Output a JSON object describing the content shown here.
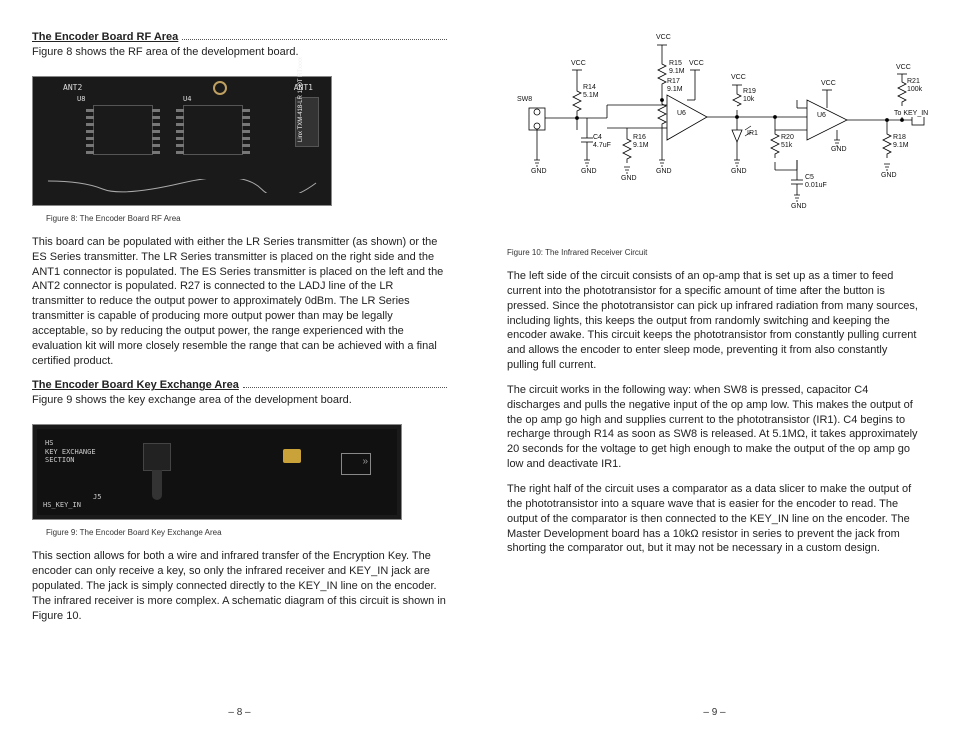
{
  "left": {
    "h1": "The Encoder Board RF Area",
    "p1": "Figure 8 shows the RF area of the development board.",
    "fig8_caption": "Figure 8: The Encoder Board RF Area",
    "fig8_labels": {
      "ant1": "ANT1",
      "ant2": "ANT2",
      "u4": "U4",
      "u8": "U8",
      "chip": "Linx  TXM-418-LR  1LOT RTxxxx"
    },
    "p2": "This board can be populated with either the LR Series transmitter (as shown) or the ES Series transmitter. The LR Series transmitter is placed on the right side and the ANT1 connector is populated. The ES Series transmitter is placed on the left and the ANT2 connector is populated. R27 is connected to the LADJ line of the LR transmitter to reduce the output power to approximately 0dBm. The LR Series transmitter is capable of producing more output power than may be legally acceptable, so by reducing the output power, the range experienced with the evaluation kit will more closely resemble the range that can be achieved with a final certified product.",
    "h2": "The Encoder Board Key Exchange Area",
    "p3": "Figure 9 shows the key exchange area of the development board.",
    "fig9_caption": "Figure 9: The Encoder Board Key Exchange Area",
    "fig9_labels": {
      "hs": "HS\nKEY EXCHANGE\nSECTION",
      "j5": "J5",
      "hk": "HS_KEY_IN"
    },
    "p4": "This section allows for both a wire and infrared transfer of the Encryption Key. The encoder can only receive a key, so only the infrared receiver and KEY_IN jack are populated. The jack is simply connected directly to the KEY_IN line on the encoder. The infrared receiver is more complex. A schematic diagram of this circuit is shown in Figure 10.",
    "pagenum": "– 8 –"
  },
  "right": {
    "fig10_caption": "Figure 10: The Infrared Receiver Circuit",
    "schematic": {
      "nets": {
        "vcc": "VCC",
        "gnd": "GND",
        "keyin": "To KEY_IN"
      },
      "parts": {
        "SW8": "SW8",
        "C4": {
          "ref": "C4",
          "val": "4.7uF"
        },
        "C5": {
          "ref": "C5",
          "val": "0.01uF"
        },
        "R14": {
          "ref": "R14",
          "val": "5.1M"
        },
        "R15": {
          "ref": "R15",
          "val": "9.1M"
        },
        "R16": {
          "ref": "R16",
          "val": "9.1M"
        },
        "R17": {
          "ref": "R17",
          "val": "9.1M"
        },
        "R18": {
          "ref": "R18",
          "val": "9.1M"
        },
        "R19": {
          "ref": "R19",
          "val": "10k"
        },
        "R20": {
          "ref": "R20",
          "val": "51k"
        },
        "R21": {
          "ref": "R21",
          "val": "100k"
        },
        "U6a": "U6",
        "U6b": "U6",
        "IR1": "IR1"
      }
    },
    "p1": "The left side of the circuit consists of an op-amp that is set up as a timer to feed current into the phototransistor for a specific amount of time after the button is pressed. Since the phototransistor can pick up infrared radiation from many sources, including lights, this keeps the output from randomly switching and keeping the encoder awake. This circuit keeps the phototransistor from constantly pulling current and allows the encoder to enter sleep mode, preventing it from also constantly pulling full current.",
    "p2": "The circuit works in the following way: when SW8 is pressed, capacitor C4 discharges and pulls the negative input of the op amp low. This makes the output of the op amp go high and supplies current to the phototransistor (IR1). C4 begins to recharge through R14 as soon as SW8 is released. At 5.1MΩ, it takes approximately 20 seconds for the voltage to get high enough to make the output of the op amp go low and deactivate IR1.",
    "p3": "The right half of the circuit uses a comparator as a data slicer to make the output of the phototransistor into a square wave that is easier for the encoder to read. The output of the comparator is then connected to the KEY_IN line on the encoder. The Master Development board has a 10kΩ resistor in series to prevent the jack from shorting the comparator out, but it may not be necessary in a custom design.",
    "pagenum": "– 9 –"
  }
}
